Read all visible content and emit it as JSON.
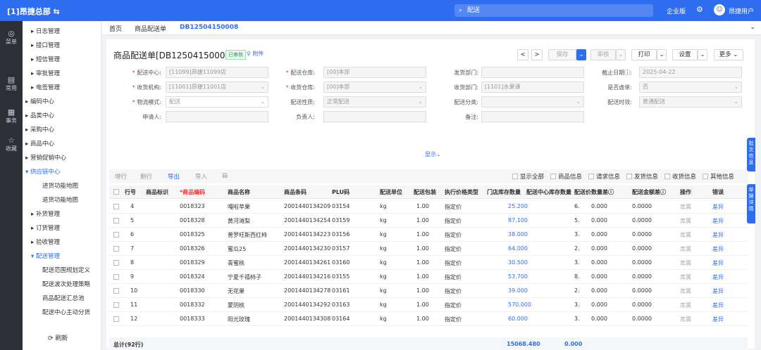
{
  "topbar": {
    "brand": "[1]昂捷总部 ⇆",
    "search_value": "配送",
    "version": "企业版",
    "user": "昂捷用户"
  },
  "rail": [
    {
      "label": "菜单",
      "icon": "◎"
    },
    {
      "label": "常用",
      "icon": "▤"
    },
    {
      "label": "事务",
      "icon": "▦"
    },
    {
      "label": "收藏",
      "icon": "☆"
    }
  ],
  "sidenav": {
    "items": [
      {
        "label": "▸ 日志管理",
        "indent": 1
      },
      {
        "label": "▸ 接口管理",
        "indent": 1
      },
      {
        "label": "▸ 短信管理",
        "indent": 1
      },
      {
        "label": "▸ 审批管理",
        "indent": 1
      },
      {
        "label": "▸ 电签管理",
        "indent": 1
      },
      {
        "label": "▸ 编码中心",
        "indent": 0
      },
      {
        "label": "▸ 品类中心",
        "indent": 0
      },
      {
        "label": "▸ 采购中心",
        "indent": 0
      },
      {
        "label": "▸ 商品中心",
        "indent": 0
      },
      {
        "label": "▸ 营销促销中心",
        "indent": 0
      },
      {
        "label": "▾ 供应链中心",
        "indent": 0,
        "active": true
      },
      {
        "label": "进货功能地图",
        "indent": 2
      },
      {
        "label": "退货功能地图",
        "indent": 2
      },
      {
        "label": "▸ 补货管理",
        "indent": 1
      },
      {
        "label": "▸ 订货管理",
        "indent": 1
      },
      {
        "label": "▸ 验收管理",
        "indent": 1
      },
      {
        "label": "▾ 配送管理",
        "indent": 1,
        "active": true
      },
      {
        "label": "配送范围规划定义",
        "indent": 2
      },
      {
        "label": "配送波次处理策略",
        "indent": 2
      },
      {
        "label": "商品配送汇总池",
        "indent": 2
      },
      {
        "label": "配送中心主动分货",
        "indent": 2
      }
    ],
    "refresh": "刷新"
  },
  "tabs": [
    {
      "label": "首页"
    },
    {
      "label": "商品配送单"
    },
    {
      "label": "DB12504150008",
      "active": true
    }
  ],
  "header": {
    "title": "商品配送单[DB12504150008]",
    "badge": "已审核",
    "attach": "附件"
  },
  "toolbar_buttons": {
    "save": "保存",
    "audit": "审核",
    "print": "打印",
    "settings": "设置",
    "more": "更多"
  },
  "form": {
    "row1": [
      {
        "label": "配送中心:",
        "req": true,
        "value": "[11099]昂捷11099店"
      },
      {
        "label": "配送仓库:",
        "req": true,
        "value": "[00]本部"
      },
      {
        "label": "发货部门:",
        "req": false,
        "value": ""
      },
      {
        "label": "截止日期ⓘ:",
        "req": false,
        "value": "2025-04-22"
      }
    ],
    "row2": [
      {
        "label": "收货机构:",
        "req": true,
        "value": "[11001]昂捷11001店"
      },
      {
        "label": "收货仓库:",
        "req": true,
        "value": "[00]本部"
      },
      {
        "label": "收货部门:",
        "req": false,
        "value": "[1101]水果课"
      },
      {
        "label": "是否虚单:",
        "req": false,
        "value": "否"
      }
    ],
    "row3": [
      {
        "label": "物流模式:",
        "req": true,
        "value": "配送"
      },
      {
        "label": "配送性质:",
        "req": false,
        "value": "正常配送"
      },
      {
        "label": "配送分类:",
        "req": false,
        "value": ""
      },
      {
        "label": "配送时效:",
        "req": false,
        "value": "普通配送"
      }
    ],
    "row4": [
      {
        "label": "申请人:",
        "req": false,
        "value": ""
      },
      {
        "label": "负责人:",
        "req": false,
        "value": ""
      },
      {
        "label": "备注:",
        "req": false,
        "value": ""
      }
    ],
    "show_more": "显示⌄"
  },
  "grid_toolbar": {
    "add": "增行",
    "del": "删行",
    "export": "导出",
    "import": "导入",
    "icon": "▤",
    "checks": [
      "显示全部",
      "商品信息",
      "请求信息",
      "发货信息",
      "收货信息",
      "其他信息"
    ]
  },
  "columns": [
    "行号",
    "商品标识",
    "*商品编码",
    "商品名称",
    "商品条码",
    "PLU码",
    "配送单位",
    "配送包装",
    "执行价格类型",
    "门店库存数量",
    "配送中心库存数量",
    "配送价",
    "数量差ⓘ",
    "配送金额差ⓘ",
    "操作",
    "错误"
  ],
  "rows": [
    {
      "no": "4",
      "code": "0018323",
      "name": "嘎啦苹果",
      "barcode": "2001440134209",
      "plu": "03154",
      "unit": "kg",
      "pack": "1.00",
      "ptype": "指定价",
      "stock": "25.200",
      "dcstock": "",
      "price": "6.",
      "qdiff": "0.000",
      "adiff": "0.0000",
      "op1": "库属",
      "op2": "差异"
    },
    {
      "no": "5",
      "code": "0018328",
      "name": "黄河滩梨",
      "barcode": "2001440134254",
      "plu": "03159",
      "unit": "kg",
      "pack": "1.00",
      "ptype": "指定价",
      "stock": "87.100",
      "dcstock": "",
      "price": "5.",
      "qdiff": "0.000",
      "adiff": "0.0000",
      "op1": "库属",
      "op2": "差异"
    },
    {
      "no": "6",
      "code": "0018325",
      "name": "普罗旺斯西红柿",
      "barcode": "2001440134223",
      "plu": "03156",
      "unit": "kg",
      "pack": "1.00",
      "ptype": "指定价",
      "stock": "38.000",
      "dcstock": "",
      "price": "3.",
      "qdiff": "0.000",
      "adiff": "0.0000",
      "op1": "库属",
      "op2": "差异"
    },
    {
      "no": "7",
      "code": "0018326",
      "name": "蜜瓜25",
      "barcode": "2001440134230",
      "plu": "03157",
      "unit": "kg",
      "pack": "1.00",
      "ptype": "指定价",
      "stock": "64.000",
      "dcstock": "",
      "price": "2.",
      "qdiff": "0.000",
      "adiff": "0.0000",
      "op1": "库属",
      "op2": "差异"
    },
    {
      "no": "8",
      "code": "0018329",
      "name": "青蜜桃",
      "barcode": "2001440134261",
      "plu": "03160",
      "unit": "kg",
      "pack": "1.00",
      "ptype": "指定价",
      "stock": "30.500",
      "dcstock": "",
      "price": "3.",
      "qdiff": "0.000",
      "adiff": "0.0000",
      "op1": "库属",
      "op2": "差异"
    },
    {
      "no": "9",
      "code": "0018324",
      "name": "宁夏千禧柿子",
      "barcode": "2001440134216",
      "plu": "03155",
      "unit": "kg",
      "pack": "1.00",
      "ptype": "指定价",
      "stock": "53.700",
      "dcstock": "",
      "price": "8.",
      "qdiff": "0.000",
      "adiff": "0.0000",
      "op1": "库属",
      "op2": "差异"
    },
    {
      "no": "10",
      "code": "0018330",
      "name": "无花果",
      "barcode": "2001440134278",
      "plu": "03161",
      "unit": "kg",
      "pack": "1.00",
      "ptype": "指定价",
      "stock": "39.000",
      "dcstock": "",
      "price": "2.",
      "qdiff": "0.000",
      "adiff": "0.0000",
      "op1": "库属",
      "op2": "差异"
    },
    {
      "no": "11",
      "code": "0018332",
      "name": "蒙阴桃",
      "barcode": "2001440134292",
      "plu": "03163",
      "unit": "kg",
      "pack": "1.00",
      "ptype": "指定价",
      "stock": "570.000",
      "dcstock": "",
      "price": "3.",
      "qdiff": "0.000",
      "adiff": "0.0000",
      "op1": "库属",
      "op2": "差异"
    },
    {
      "no": "12",
      "code": "0018333",
      "name": "阳光玫瑰",
      "barcode": "2001440134308",
      "plu": "03164",
      "unit": "kg",
      "pack": "1.00",
      "ptype": "指定价",
      "stock": "60.000",
      "dcstock": "",
      "price": "3.",
      "qdiff": "0.000",
      "adiff": "0.0000",
      "op1": "库属",
      "op2": "差异"
    }
  ],
  "summary": {
    "label": "总计(92行)",
    "stock_total": "15068.480",
    "dc_total": "0.000"
  },
  "side_tabs": [
    "批次信息",
    "单据详情"
  ]
}
